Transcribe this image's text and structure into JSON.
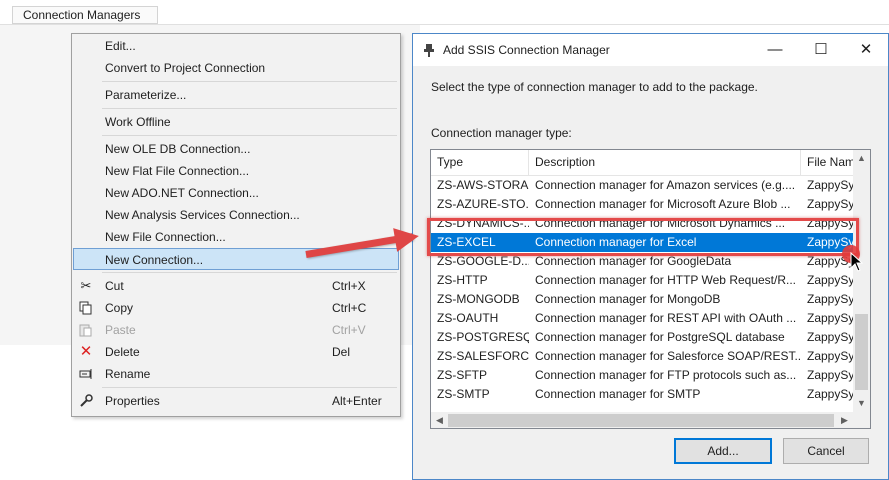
{
  "background": {
    "tab_label": "Connection Managers"
  },
  "context_menu": {
    "items": [
      {
        "label": "Edit...",
        "shortcut": "",
        "icon": "",
        "disabled": false
      },
      {
        "label": "Convert to Project Connection",
        "shortcut": "",
        "icon": "",
        "disabled": false
      },
      {
        "label": "Parameterize...",
        "shortcut": "",
        "icon": "",
        "disabled": false
      },
      {
        "label": "Work Offline",
        "shortcut": "",
        "icon": "",
        "disabled": false
      },
      {
        "label": "New OLE DB Connection...",
        "shortcut": "",
        "icon": "",
        "disabled": false
      },
      {
        "label": "New Flat File Connection...",
        "shortcut": "",
        "icon": "",
        "disabled": false
      },
      {
        "label": "New ADO.NET Connection...",
        "shortcut": "",
        "icon": "",
        "disabled": false
      },
      {
        "label": "New Analysis Services Connection...",
        "shortcut": "",
        "icon": "",
        "disabled": false
      },
      {
        "label": "New File Connection...",
        "shortcut": "",
        "icon": "",
        "disabled": false
      },
      {
        "label": "New Connection...",
        "shortcut": "",
        "icon": "",
        "disabled": false,
        "highlighted": true
      },
      {
        "label": "Cut",
        "shortcut": "Ctrl+X",
        "icon": "scissors-icon",
        "disabled": false
      },
      {
        "label": "Copy",
        "shortcut": "Ctrl+C",
        "icon": "copy-icon",
        "disabled": false
      },
      {
        "label": "Paste",
        "shortcut": "Ctrl+V",
        "icon": "paste-icon",
        "disabled": true
      },
      {
        "label": "Delete",
        "shortcut": "Del",
        "icon": "delete-icon",
        "disabled": false
      },
      {
        "label": "Rename",
        "shortcut": "",
        "icon": "rename-icon",
        "disabled": false
      },
      {
        "label": "Properties",
        "shortcut": "Alt+Enter",
        "icon": "wrench-icon",
        "disabled": false
      }
    ]
  },
  "dialog": {
    "title": "Add SSIS Connection Manager",
    "title_icon": "connection-plug-icon",
    "description": "Select the type of connection manager to add to the package.",
    "type_label": "Connection manager type:",
    "columns": [
      "Type",
      "Description",
      "File Nam"
    ],
    "rows": [
      {
        "type": "ZS-AWS-STORA...",
        "description": "Connection manager for Amazon services (e.g....",
        "file": "ZappySy"
      },
      {
        "type": "ZS-AZURE-STO...",
        "description": "Connection manager for Microsoft Azure Blob ...",
        "file": "ZappySy"
      },
      {
        "type": "ZS-DYNAMICS-...",
        "description": "Connection manager for Microsoft Dynamics ...",
        "file": "ZappySy"
      },
      {
        "type": "ZS-EXCEL",
        "description": "Connection manager for Excel",
        "file": "ZappySy",
        "selected": true
      },
      {
        "type": "ZS-GOOGLE-D...",
        "description": "Connection manager for GoogleData",
        "file": "ZappySy"
      },
      {
        "type": "ZS-HTTP",
        "description": "Connection manager for HTTP Web Request/R...",
        "file": "ZappySy"
      },
      {
        "type": "ZS-MONGODB",
        "description": "Connection manager for MongoDB",
        "file": "ZappySy"
      },
      {
        "type": "ZS-OAUTH",
        "description": "Connection manager for REST API with OAuth ...",
        "file": "ZappySy"
      },
      {
        "type": "ZS-POSTGRESQL",
        "description": "Connection manager for PostgreSQL database",
        "file": "ZappySy"
      },
      {
        "type": "ZS-SALESFORCE",
        "description": "Connection manager for Salesforce SOAP/REST...",
        "file": "ZappySy"
      },
      {
        "type": "ZS-SFTP",
        "description": "Connection manager for FTP protocols such as...",
        "file": "ZappySy"
      },
      {
        "type": "ZS-SMTP",
        "description": "Connection manager for SMTP",
        "file": "ZappySy"
      }
    ],
    "add_button": "Add...",
    "cancel_button": "Cancel"
  },
  "colors": {
    "selection": "#0078d7",
    "menu_highlight": "#cce4f7",
    "annotation_red": "#e34a4a"
  }
}
